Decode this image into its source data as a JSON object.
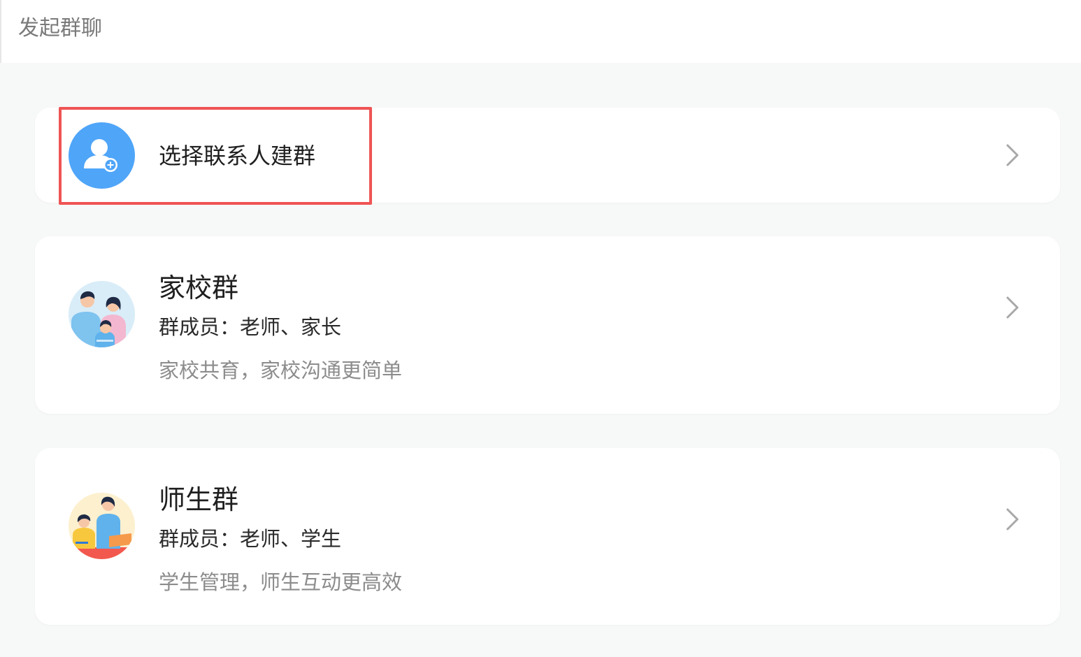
{
  "header": {
    "title": "发起群聊"
  },
  "options": [
    {
      "title": "选择联系人建群",
      "icon": "add-contact-icon",
      "accent": "#4fa5f8"
    },
    {
      "title": "家校群",
      "members": "群成员：老师、家长",
      "description": "家校共育，家校沟通更简单",
      "icon": "family-illustration-icon"
    },
    {
      "title": "师生群",
      "members": "群成员：老师、学生",
      "description": "学生管理，师生互动更高效",
      "icon": "teacher-student-illustration-icon"
    }
  ],
  "colors": {
    "highlight_border": "#ef5454",
    "background": "#f7f8f8"
  }
}
